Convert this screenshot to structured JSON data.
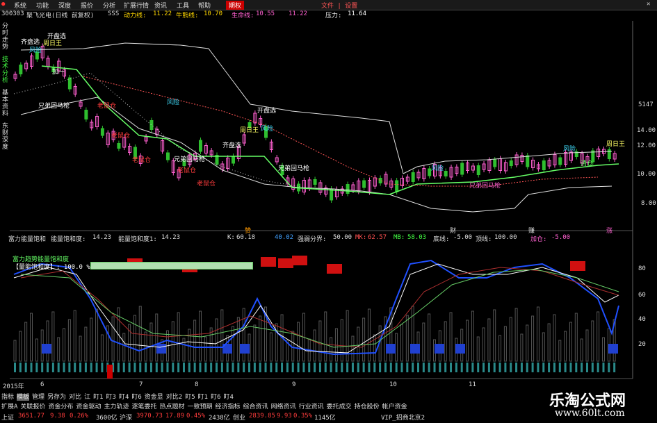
{
  "menu": {
    "items": [
      "系统",
      "功能",
      "深度",
      "报价",
      "分析",
      "扩展行情",
      "资讯",
      "工具",
      "帮助"
    ],
    "active": "期权",
    "right": "文件 | 设置"
  },
  "header": {
    "code": "300303",
    "name": "聚飞光电(日线 前复权)",
    "sss": "SSS",
    "dyx_label": "动力线:",
    "dyx_val": "11.22",
    "nsx_label": "牛熊线:",
    "nsx_val": "10.70",
    "smx_label": "生命线:",
    "smx_val": "10.55",
    "val4": "11.22",
    "yl_label": "压力:",
    "yl_val": "11.64"
  },
  "sidebar": {
    "tabs": [
      "分时走势",
      "技术分析",
      "基本资料",
      "东财深度"
    ]
  },
  "price_axis": {
    "labels": [
      "5147",
      "14.00",
      "12.00",
      "10.00",
      "8.00"
    ]
  },
  "annotations": [
    "开盘选",
    "齐盘选",
    "风险",
    "周日王",
    "加一",
    "兄弟回马枪",
    "老鼠仓",
    "老鼠仓",
    "老鼠仓",
    "老鼠仓",
    "风险",
    "兄弟回马枪",
    "老鼠仓",
    "开盘选",
    "周日王",
    "齐盘选",
    "风险",
    "兄弟回马枪",
    "风险",
    "风险",
    "清仓",
    "周日王",
    "兄弟回马枪"
  ],
  "indicator": {
    "title": "富力能量饱和",
    "sub_label": "能量饱和度:",
    "sub_val": "14.23",
    "sub2_label": "能量饱和度1:",
    "sub2_val": "14.23",
    "k_label": "K:",
    "k_val": "60.18",
    "d_val": "40.02",
    "qr_label": "强弱分界:",
    "qr_val": "50.00",
    "mk_label": "MK:",
    "mk_val": "62.57",
    "mb_label": "MB:",
    "mb_val": "58.03",
    "dx_label": "底线:",
    "dx_val": "-5.00",
    "dd_label": "顶线:",
    "dd_val": "100.00",
    "jc_label": "加仓:",
    "jc_val": "-5.00",
    "markers": [
      "赞",
      "财",
      "赚",
      "涨"
    ],
    "legend1": "富力趋势能量饱和度",
    "legend2": "【量能饱和度】: 100.0 %",
    "axis": [
      "80",
      "60",
      "40",
      "20"
    ]
  },
  "dates": {
    "year": "2015年",
    "months": [
      "6",
      "7",
      "8",
      "9",
      "10",
      "11"
    ]
  },
  "bottom_nav": {
    "row1": [
      "指标",
      "模板",
      "管理",
      "另存为",
      "对比",
      "江",
      "盯1",
      "盯3",
      "盯4",
      "盯6",
      "资金显",
      "对比2",
      "盯5",
      "盯1",
      "盯6",
      "盯4"
    ],
    "row2": [
      "扩展A",
      "关联报价",
      "资金分布",
      "资金驱动",
      "主力轨迹",
      "逐笔委托",
      "热点题材",
      "一致预期",
      "经济指标",
      "综合资讯",
      "网络资讯",
      "行业资讯",
      "委托成交",
      "持仓股份",
      "帐户资金"
    ]
  },
  "ticker": [
    {
      "label": "上证",
      "value": "3651.77",
      "chg": "9.38",
      "pct": "0.26%",
      "vol": "3600亿"
    },
    {
      "label": "沪深",
      "value": "3970.73",
      "chg": "17.89",
      "pct": "0.45%",
      "vol": "2438亿"
    },
    {
      "label": "创业",
      "value": "2839.85",
      "chg": "9.93",
      "pct": "0.35%",
      "vol": "1145亿"
    }
  ],
  "status_right": "VIP_招商北京2",
  "watermark": {
    "title": "乐淘公式网",
    "url": "www.60lt.com"
  },
  "colors": {
    "up": "#ff3c3c",
    "down": "#2fbf2f",
    "kline_up": "#ff60d0",
    "accent": "#ffd700",
    "cyan": "#40e0ff"
  }
}
